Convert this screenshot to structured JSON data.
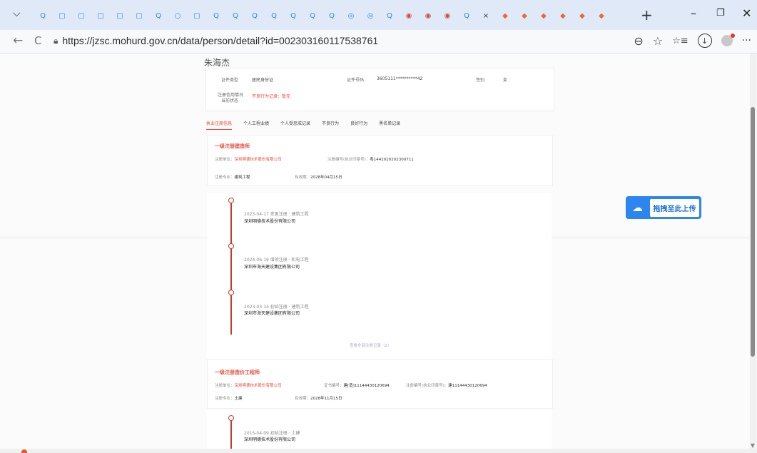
{
  "browser": {
    "menu_glyph": "⌵",
    "tabs": [
      "Q",
      "▢",
      "▢",
      "▢",
      "▢",
      "▢",
      "Q",
      "○",
      "▢",
      "Q",
      "Q",
      "Q",
      "Q",
      "Q",
      "Q",
      "Q",
      "◎",
      "◎",
      "Q",
      "◉",
      "◉",
      "◉",
      "Q",
      "◆",
      "◆",
      "◆",
      "◆",
      "◆",
      "◆"
    ],
    "tab_close": "×",
    "new_tab": "+",
    "minimize": "–",
    "restore": "❐",
    "close": "✕",
    "back": "←",
    "reload": "C",
    "url": "https://jzsc.mohurd.gov.cn/data/person/detail?id=002303160117538761",
    "zoom_icon": "⊖",
    "star_icon": "☆",
    "favorites_icon": "☆≡",
    "download_icon": "↓",
    "more_icon": "···"
  },
  "page": {
    "person_name": "朱海杰",
    "info": {
      "id_type_label": "证件类型",
      "id_type_value": "居民身份证",
      "id_no_label": "证件号码",
      "id_no_value": "3605111**********42",
      "gender_label": "性别",
      "gender_value": "女",
      "credit_label": "注册信用情况",
      "credit_label2": "当前状态",
      "credit_value": "不良行为记录：暂无"
    },
    "subtabs": [
      "执业注册信息",
      "个人工程业绩",
      "个人受惩戒记录",
      "不良行为",
      "良好行为",
      "黑名单记录"
    ],
    "card1": {
      "title": "一级注册建造师",
      "unit_label": "注册单位：",
      "unit_value": "深圳明德技术股份有限公司",
      "cert_label": "注册编号(执业印章号)：",
      "cert_value": "粤1442020202300711",
      "major_label": "注册专业：",
      "major_value": "建筑工程",
      "valid_label": "有效期：",
      "valid_value": "2028年04月15日"
    },
    "timeline": [
      {
        "date": "2023-04-17  变更注册 · 建筑工程",
        "company": "深圳明德技术股份有限公司"
      },
      {
        "date": "2024-06-19  增项注册 · 机电工程",
        "company": "深圳市海天建设集团有限公司"
      },
      {
        "date": "2023-03-14  初始注册 · 建筑工程",
        "company": "深圳市海天建设集团有限公司"
      }
    ],
    "more_link": "查看全部注册记录（2）",
    "card2": {
      "title": "一级注册造价工程师",
      "unit_label": "注册单位：",
      "unit_value": "深圳明德技术股份有限公司",
      "cert_label": "证书编号：",
      "cert_value": "建[造]11144430120694",
      "seal_label": "注册编号(执业印章号)：",
      "seal_value": "建11144430120694",
      "major_label": "注册专业：",
      "major_value": "土建",
      "valid_label": "有效期：",
      "valid_value": "2028年11月15日"
    },
    "timeline2": [
      {
        "date": "2015-04-09  初始注册 · 土建",
        "company": "深圳明德技术股份有限公司"
      }
    ]
  },
  "upload": {
    "icon": "☁",
    "label": "拖拽至此上传"
  }
}
